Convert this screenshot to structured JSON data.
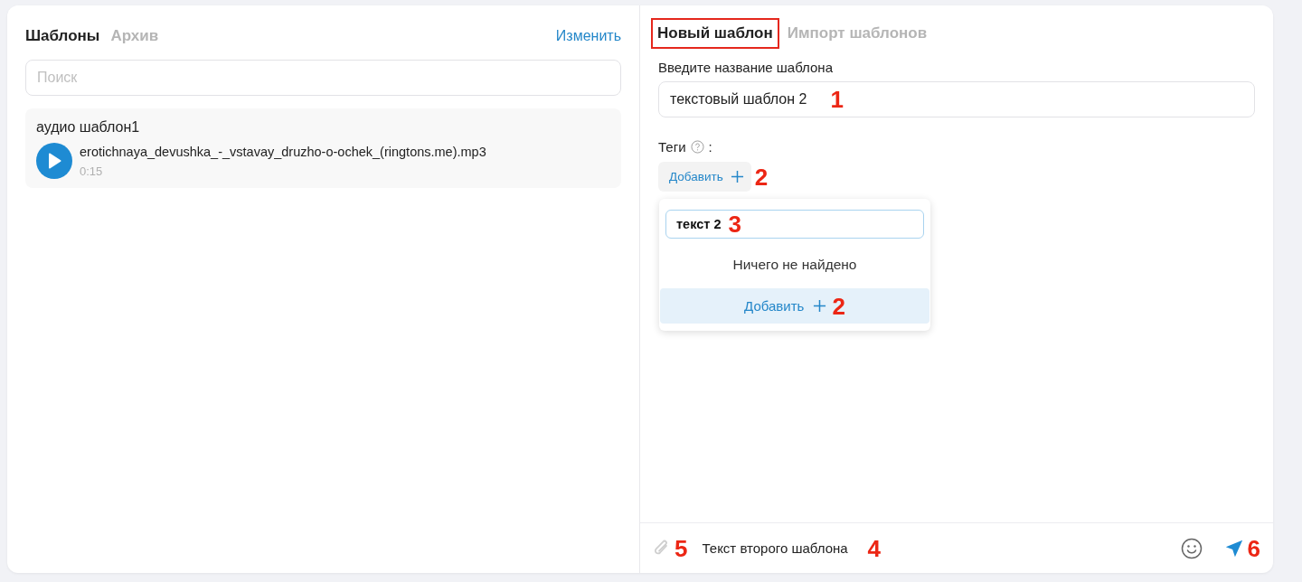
{
  "left_panel": {
    "tabs": [
      {
        "label": "Шаблоны",
        "selected": true
      },
      {
        "label": "Архив",
        "selected": false
      }
    ],
    "edit_link": "Изменить",
    "search": {
      "placeholder": "Поиск"
    },
    "templates": [
      {
        "kind": "audio",
        "title": "аудио шаблон1",
        "file_name": "erotichnaya_devushka_-_vstavay_druzho-o-ochek_(ringtons.me).mp3",
        "duration": "0:15"
      }
    ]
  },
  "right_panel": {
    "tabs": [
      {
        "label": "Новый шаблон",
        "selected": true,
        "highlighted": true
      },
      {
        "label": "Импорт шаблонов",
        "selected": false,
        "highlighted": false
      }
    ],
    "name_field": {
      "label": "Введите название шаблона",
      "value": "текстовый шаблон 2",
      "marker": "1"
    },
    "tags": {
      "label": "Теги",
      "separator": ":",
      "add_button": {
        "label": "Добавить",
        "marker": "2"
      },
      "dropdown": {
        "search_value": "текст 2",
        "search_marker": "3",
        "empty_text": "Ничего не найдено",
        "add_option": {
          "label": "Добавить",
          "marker": "2"
        }
      }
    },
    "composer": {
      "value": "Текст второго шаблона",
      "value_marker": "4",
      "attach_marker": "5",
      "send_marker": "6"
    }
  }
}
